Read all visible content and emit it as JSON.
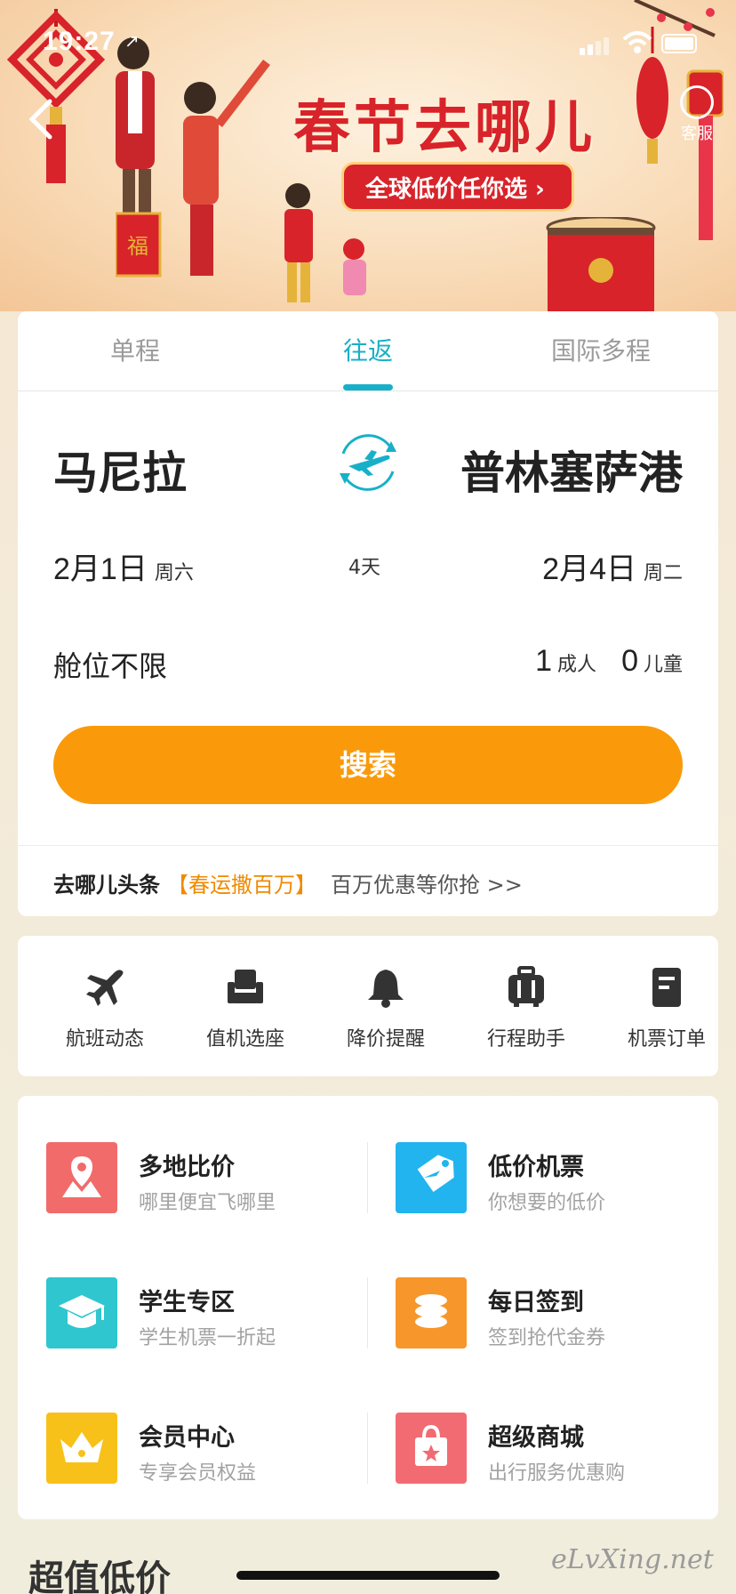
{
  "status_bar": {
    "time": "19:27",
    "location_arrow": "↗"
  },
  "banner": {
    "title": "春节去哪儿",
    "cta": "全球低价任你选 ›",
    "service_label": "客服"
  },
  "tabs": [
    "单程",
    "往返",
    "国际多程"
  ],
  "active_tab": "往返",
  "route": {
    "from": "马尼拉",
    "to": "普林塞萨港"
  },
  "dates": {
    "depart_date": "2月1日",
    "depart_weekday": "周六",
    "duration": "4天",
    "return_date": "2月4日",
    "return_weekday": "周二"
  },
  "cabin": "舱位不限",
  "passengers": {
    "adults": "1",
    "adult_label": "成人",
    "children": "0",
    "child_label": "儿童"
  },
  "search_label": "搜索",
  "news": {
    "brand": "去哪儿头条",
    "tag": "【春运撒百万】",
    "text": "百万优惠等你抢 >>"
  },
  "tools": [
    {
      "label": "航班动态",
      "icon": "airplane-icon"
    },
    {
      "label": "值机选座",
      "icon": "seat-icon"
    },
    {
      "label": "降价提醒",
      "icon": "bell-icon"
    },
    {
      "label": "行程助手",
      "icon": "luggage-icon"
    },
    {
      "label": "机票订单",
      "icon": "order-icon"
    }
  ],
  "features": [
    {
      "title": "多地比价",
      "subtitle": "哪里便宜飞哪里",
      "icon": "map-icon",
      "color": "#f26b6b"
    },
    {
      "title": "低价机票",
      "subtitle": "你想要的低价",
      "icon": "tag-icon",
      "color": "#22b4ee"
    },
    {
      "title": "学生专区",
      "subtitle": "学生机票一折起",
      "icon": "graduation-cap-icon",
      "color": "#2fc6d0"
    },
    {
      "title": "每日签到",
      "subtitle": "签到抢代金券",
      "icon": "coins-icon",
      "color": "#f7962b"
    },
    {
      "title": "会员中心",
      "subtitle": "专享会员权益",
      "icon": "crown-icon",
      "color": "#f8c11a"
    },
    {
      "title": "超级商城",
      "subtitle": "出行服务优惠购",
      "icon": "shopping-bag-icon",
      "color": "#f26b72"
    }
  ],
  "section_title": "超值低价",
  "watermark": "eLvXing.net",
  "colors": {
    "accent": "#18b0c8",
    "search_button": "#fa9a0a",
    "banner_red": "#d8232a",
    "news_tag": "#f08a00"
  }
}
